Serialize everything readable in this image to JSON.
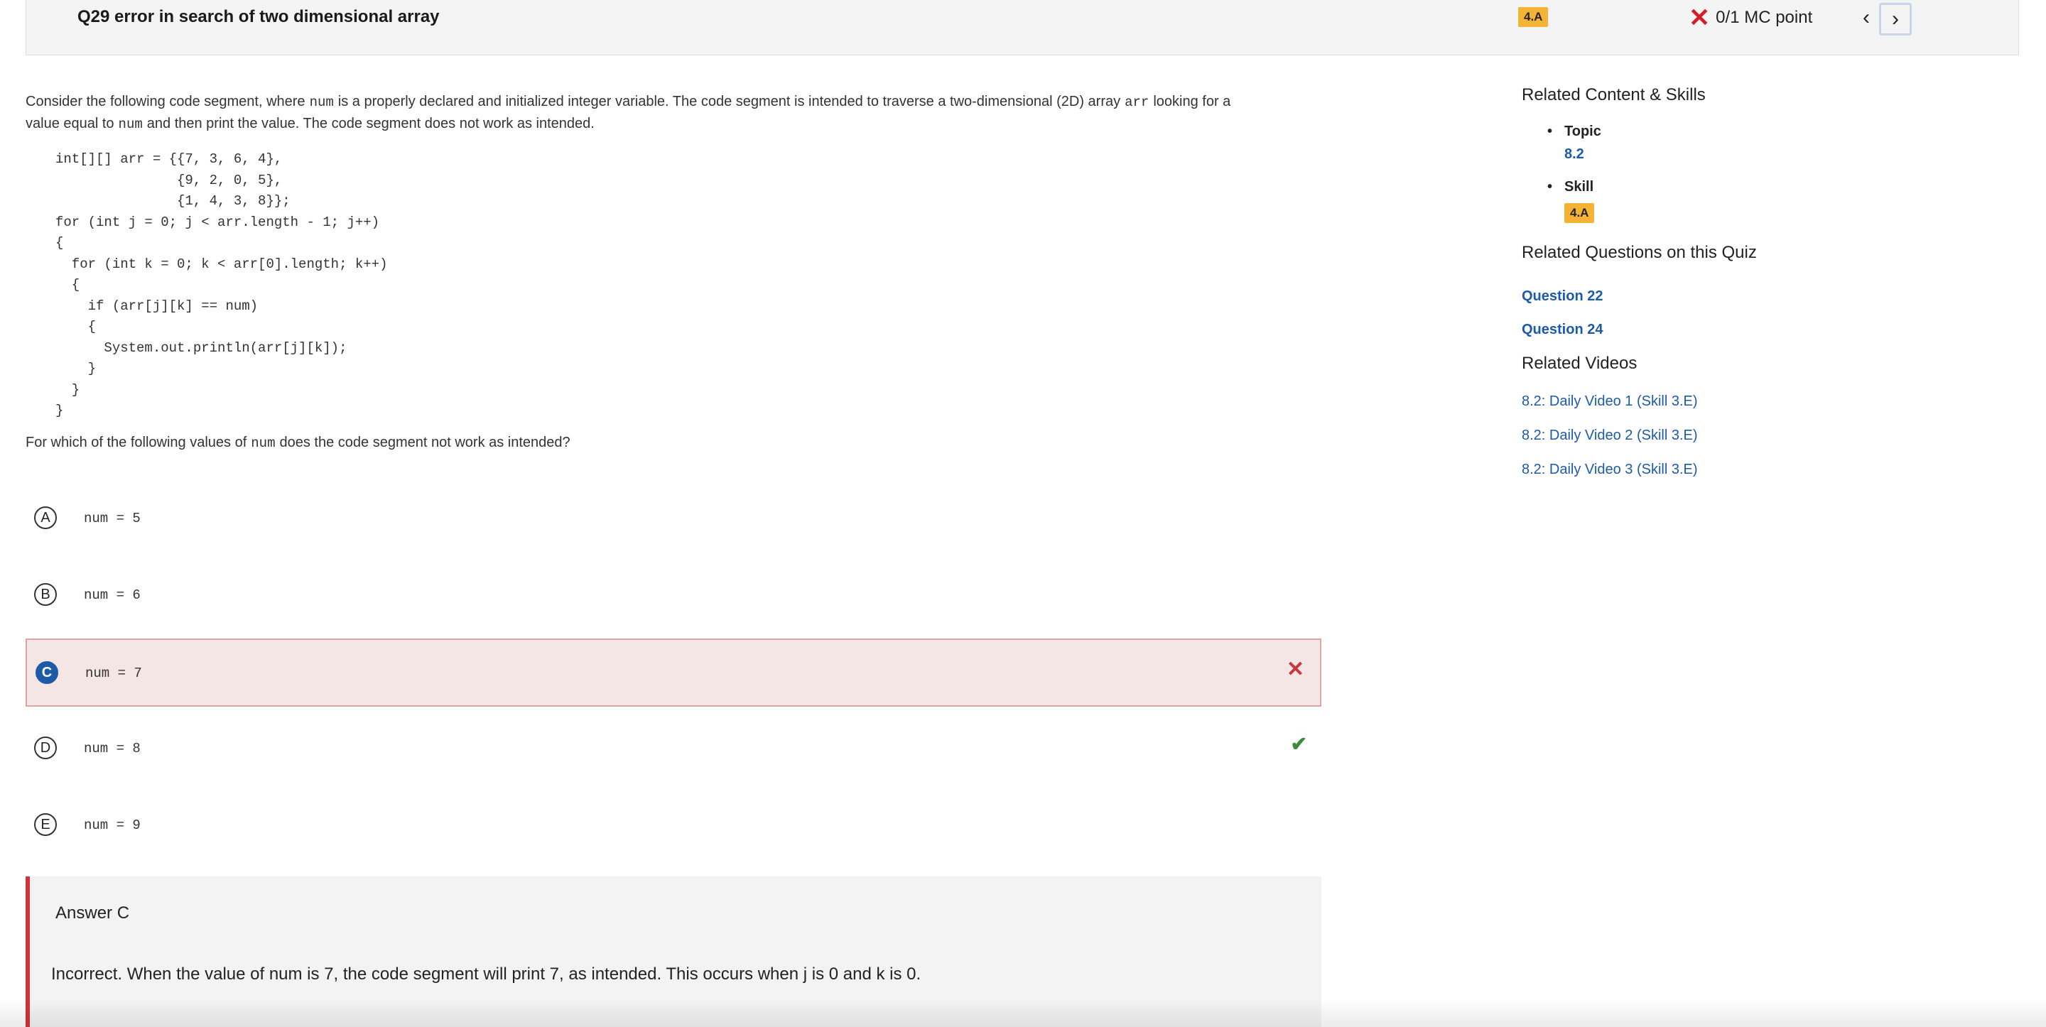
{
  "header": {
    "title": "Q29 error in search of two dimensional array",
    "badge": "4.A",
    "score_icon": "x-icon",
    "score_text": "0/1 MC point",
    "prev_icon": "chevron-left-icon",
    "next_icon": "chevron-right-icon"
  },
  "prompt": {
    "p1": "Consider the following code segment, where",
    "c1": "num",
    "p2": "is a properly declared and initialized integer variable. The code segment is intended to traverse a two-dimensional (2D) array",
    "c2": "arr",
    "p3": "looking for a",
    "p4": "value equal to",
    "c3": "num",
    "p5": "and then print the value. The code segment does not work as intended."
  },
  "code_lines": [
    "int[][] arr = {{7, 3, 6, 4},",
    "               {9, 2, 0, 5},",
    "               {1, 4, 3, 8}};",
    "for (int j = 0; j < arr.length - 1; j++)",
    "{",
    "  for (int k = 0; k < arr[0].length; k++)",
    "  {",
    "    if (arr[j][k] == num)",
    "    {",
    "      System.out.println(arr[j][k]);",
    "    }",
    "  }",
    "}"
  ],
  "question": {
    "q1": "For which of the following values of",
    "c1": "num",
    "q2": "does the code segment not work as intended?"
  },
  "choices": [
    {
      "letter": "A",
      "value": "num = 5"
    },
    {
      "letter": "B",
      "value": "num = 6"
    },
    {
      "letter": "C",
      "value": "num = 7"
    },
    {
      "letter": "D",
      "value": "num = 8"
    },
    {
      "letter": "E",
      "value": "num = 9"
    }
  ],
  "selected_choice": "C",
  "correct_choice": "D",
  "answer": {
    "title": "Answer C",
    "text": "Incorrect. When the value of num is 7, the code segment will print 7, as intended. This occurs when j is 0 and k is 0."
  },
  "sidebar": {
    "related_title": "Related Content & Skills",
    "topic_label": "Topic",
    "topic_value": "8.2",
    "skill_label": "Skill",
    "skill_value": "4.A",
    "related_questions_title": "Related Questions on this Quiz",
    "related_questions": [
      "Question 22",
      "Question 24"
    ],
    "videos_title": "Related Videos",
    "videos": [
      "8.2: Daily Video 1 (Skill 3.E)",
      "8.2: Daily Video 2 (Skill 3.E)",
      "8.2: Daily Video 3 (Skill 3.E)"
    ]
  },
  "colors": {
    "accent_blue": "#1d5aa7",
    "badge_yellow": "#f5b335",
    "incorrect_red": "#d21f26",
    "correct_green": "#3c8c3c"
  }
}
